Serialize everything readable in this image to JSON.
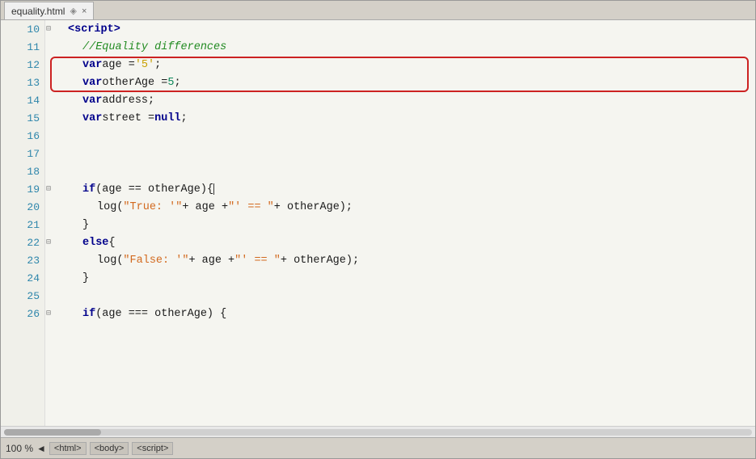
{
  "tab": {
    "filename": "equality.html",
    "close_label": "×"
  },
  "lines": [
    {
      "num": 10,
      "fold": true,
      "indent": 1,
      "tokens": [
        {
          "t": "kw",
          "v": "<script>"
        }
      ]
    },
    {
      "num": 11,
      "fold": false,
      "indent": 2,
      "tokens": [
        {
          "t": "comment",
          "v": "//Equality differences"
        }
      ]
    },
    {
      "num": 12,
      "fold": false,
      "indent": 2,
      "tokens": [
        {
          "t": "kw",
          "v": "var"
        },
        {
          "t": "plain",
          "v": " age = "
        },
        {
          "t": "str",
          "v": "'5'"
        },
        {
          "t": "plain",
          "v": ";"
        }
      ],
      "highlight": true
    },
    {
      "num": 13,
      "fold": false,
      "indent": 2,
      "tokens": [
        {
          "t": "kw",
          "v": "var"
        },
        {
          "t": "plain",
          "v": " otherAge = "
        },
        {
          "t": "num",
          "v": "5"
        },
        {
          "t": "plain",
          "v": ";"
        }
      ],
      "highlight": true
    },
    {
      "num": 14,
      "fold": false,
      "indent": 2,
      "tokens": [
        {
          "t": "kw",
          "v": "var"
        },
        {
          "t": "plain",
          "v": " address;"
        }
      ]
    },
    {
      "num": 15,
      "fold": false,
      "indent": 2,
      "tokens": [
        {
          "t": "kw",
          "v": "var"
        },
        {
          "t": "plain",
          "v": " street = "
        },
        {
          "t": "kw",
          "v": "null"
        },
        {
          "t": "plain",
          "v": ";"
        }
      ]
    },
    {
      "num": 16,
      "fold": false,
      "indent": 0,
      "tokens": []
    },
    {
      "num": 17,
      "fold": false,
      "indent": 0,
      "tokens": []
    },
    {
      "num": 18,
      "fold": false,
      "indent": 0,
      "tokens": []
    },
    {
      "num": 19,
      "fold": true,
      "indent": 2,
      "tokens": [
        {
          "t": "kw",
          "v": "if"
        },
        {
          "t": "plain",
          "v": " (age == otherAge) "
        },
        {
          "t": "plain",
          "v": "{"
        },
        {
          "t": "cursor",
          "v": ""
        }
      ]
    },
    {
      "num": 20,
      "fold": false,
      "indent": 3,
      "tokens": [
        {
          "t": "fn",
          "v": "log"
        },
        {
          "t": "plain",
          "v": "("
        },
        {
          "t": "log-str",
          "v": "\"True: '\""
        },
        {
          "t": "plain",
          "v": " + age + "
        },
        {
          "t": "log-str",
          "v": "\"' == \""
        },
        {
          "t": "plain",
          "v": " + otherAge);"
        }
      ]
    },
    {
      "num": 21,
      "fold": false,
      "indent": 2,
      "tokens": [
        {
          "t": "plain",
          "v": "}"
        }
      ]
    },
    {
      "num": 22,
      "fold": true,
      "indent": 2,
      "tokens": [
        {
          "t": "kw",
          "v": "else"
        },
        {
          "t": "plain",
          "v": " {"
        }
      ]
    },
    {
      "num": 23,
      "fold": false,
      "indent": 3,
      "tokens": [
        {
          "t": "fn",
          "v": "log"
        },
        {
          "t": "plain",
          "v": "("
        },
        {
          "t": "log-str",
          "v": "\"False: '\""
        },
        {
          "t": "plain",
          "v": " + age + "
        },
        {
          "t": "log-str",
          "v": "\"' == \""
        },
        {
          "t": "plain",
          "v": " + otherAge);"
        }
      ]
    },
    {
      "num": 24,
      "fold": false,
      "indent": 2,
      "tokens": [
        {
          "t": "plain",
          "v": "}"
        }
      ]
    },
    {
      "num": 25,
      "fold": false,
      "indent": 0,
      "tokens": []
    },
    {
      "num": 26,
      "fold": true,
      "indent": 2,
      "tokens": [
        {
          "t": "kw",
          "v": "if"
        },
        {
          "t": "plain",
          "v": " (age === otherAge) {"
        }
      ]
    }
  ],
  "status": {
    "zoom": "100 %",
    "arrow_left": "◄",
    "tags": [
      "<html>",
      "<body>",
      "<script>"
    ]
  }
}
